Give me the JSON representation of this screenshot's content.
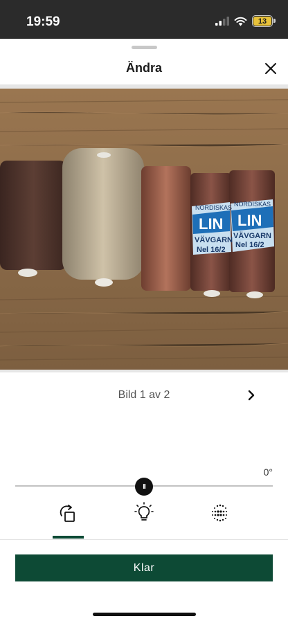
{
  "status_bar": {
    "time": "19:59",
    "battery_level": "13",
    "battery_color": "#e8c23a"
  },
  "sheet": {
    "title": "Ändra",
    "close_icon": "close-icon"
  },
  "photo": {
    "description_icon": "yarn-photo",
    "label_text_1": "NORDISKAS",
    "label_text_2": "LIN",
    "label_text_3": "VÄVGARN",
    "label_text_4": "Nel 16/2"
  },
  "pager": {
    "label": "Bild 1 av 2",
    "next_icon": "chevron-right-icon"
  },
  "rotation": {
    "value": "0°",
    "slider_position": 0.5,
    "thumb_label": "II"
  },
  "tools": [
    {
      "name": "rotate-icon"
    },
    {
      "name": "lightbulb-icon"
    },
    {
      "name": "filter-dots-icon"
    }
  ],
  "active_tool_index": 0,
  "done_button": {
    "label": "Klar"
  },
  "colors": {
    "accent": "#0d4a35"
  }
}
